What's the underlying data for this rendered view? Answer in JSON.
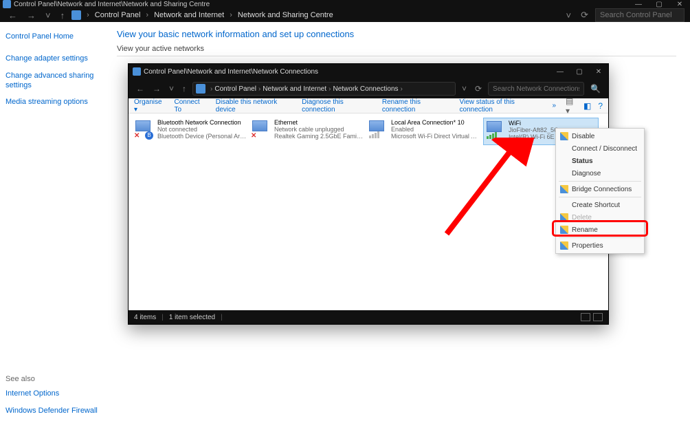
{
  "outer_window": {
    "title": "Control Panel\\Network and Internet\\Network and Sharing Centre",
    "breadcrumb": [
      "Control Panel",
      "Network and Internet",
      "Network and Sharing Centre"
    ],
    "search_placeholder": "Search Control Panel"
  },
  "sidebar": {
    "home": "Control Panel Home",
    "items": [
      "Change adapter settings",
      "Change advanced sharing settings",
      "Media streaming options"
    ],
    "see_also_label": "See also",
    "see_also": [
      "Internet Options",
      "Windows Defender Firewall"
    ]
  },
  "main": {
    "heading": "View your basic network information and set up connections",
    "active_networks_label": "View your active networks"
  },
  "inner_window": {
    "title": "Control Panel\\Network and Internet\\Network Connections",
    "breadcrumb": [
      "Control Panel",
      "Network and Internet",
      "Network Connections"
    ],
    "search_placeholder": "Search Network Connections",
    "toolbar": {
      "organise": "Organise ▾",
      "connect_to": "Connect To",
      "disable": "Disable this network device",
      "diagnose": "Diagnose this connection",
      "rename": "Rename this connection",
      "view_status": "View status of this connection",
      "overflow": "»"
    },
    "items": [
      {
        "name": "Bluetooth Network Connection",
        "status": "Not connected",
        "device": "Bluetooth Device (Personal Area ...",
        "kind": "bt",
        "selected": false
      },
      {
        "name": "Ethernet",
        "status": "Network cable unplugged",
        "device": "Realtek Gaming 2.5GbE Family Co...",
        "kind": "eth",
        "selected": false
      },
      {
        "name": "Local Area Connection* 10",
        "status": "Enabled",
        "device": "Microsoft Wi-Fi Direct Virtual Ada...",
        "kind": "wifigrey",
        "selected": false
      },
      {
        "name": "WiFi",
        "status": "JioFiber-Aft82_5G",
        "device": "Intel(R) Wi-Fi 6E AX211 160MH...",
        "kind": "wifi",
        "selected": true
      }
    ],
    "statusbar": {
      "count": "4 items",
      "selected": "1 item selected"
    }
  },
  "context_menu": {
    "items": [
      {
        "label": "Disable",
        "shield": true
      },
      {
        "label": "Connect / Disconnect"
      },
      {
        "label": "Status",
        "bold": true
      },
      {
        "label": "Diagnose"
      },
      {
        "sep": true
      },
      {
        "label": "Bridge Connections",
        "shield": true
      },
      {
        "sep": true
      },
      {
        "label": "Create Shortcut"
      },
      {
        "label": "Delete",
        "shield": true,
        "disabled": true
      },
      {
        "label": "Rename",
        "shield": true
      },
      {
        "sep": true
      },
      {
        "label": "Properties",
        "shield": true,
        "highlight": true
      }
    ]
  }
}
